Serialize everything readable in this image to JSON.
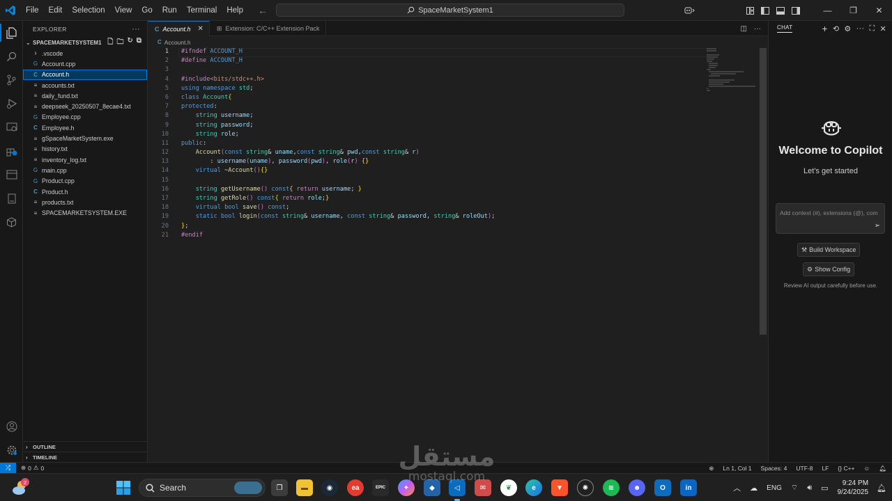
{
  "titlebar": {
    "menu": [
      "File",
      "Edit",
      "Selection",
      "View",
      "Go",
      "Run",
      "Terminal",
      "Help"
    ],
    "command_center": "SpaceMarketSystem1"
  },
  "explorer": {
    "header": "EXPLORER",
    "workspace": "SPACEMARKETSYSTEM1",
    "items": [
      {
        "name": ".vscode",
        "kind": "folder"
      },
      {
        "name": "Account.cpp",
        "kind": "cpp"
      },
      {
        "name": "Account.h",
        "kind": "c",
        "selected": true
      },
      {
        "name": "accounts.txt",
        "kind": "txt"
      },
      {
        "name": "daily_fund.txt",
        "kind": "txt"
      },
      {
        "name": "deepseek_20250507_8ecae4.txt",
        "kind": "txt"
      },
      {
        "name": "Employee.cpp",
        "kind": "cpp"
      },
      {
        "name": "Employee.h",
        "kind": "c"
      },
      {
        "name": "gSpaceMarketSystem.exe",
        "kind": "txt"
      },
      {
        "name": "history.txt",
        "kind": "txt"
      },
      {
        "name": "inventory_log.txt",
        "kind": "txt"
      },
      {
        "name": "main.cpp",
        "kind": "cpp"
      },
      {
        "name": "Product.cpp",
        "kind": "cpp"
      },
      {
        "name": "Product.h",
        "kind": "c"
      },
      {
        "name": "products.txt",
        "kind": "txt"
      },
      {
        "name": "SPACEMARKETSYSTEM.EXE",
        "kind": "txt"
      }
    ],
    "outline": "OUTLINE",
    "timeline": "TIMELINE"
  },
  "editor": {
    "tabs": [
      {
        "label": "Account.h",
        "active": true
      },
      {
        "label": "Extension: C/C++ Extension Pack",
        "active": false
      }
    ],
    "breadcrumb": "Account.h",
    "lines": [
      "#ifndef ACCOUNT_H",
      "#define ACCOUNT_H",
      "",
      "#include<bits/stdc++.h>",
      "using namespace std;",
      "class Account{",
      "protected:",
      "    string username;",
      "    string password;",
      "    string role;",
      "public:",
      "    Account(const string& uname,const string& pwd,const string& r)",
      "        : username(uname), password(pwd), role(r) {}",
      "    virtual ~Account(){}",
      "",
      "    string getUsername() const{ return username; }",
      "    string getRole() const{ return role;}",
      "    virtual bool save() const;",
      "    static bool login(const string& username, const string& password, string& roleOut);",
      "};",
      "#endif"
    ]
  },
  "chat": {
    "header": "CHAT",
    "welcome": "Welcome to Copilot",
    "subtitle": "Let's get started",
    "input_placeholder": "Add context (#), extensions (@), com",
    "build_button": "Build Workspace",
    "config_button": "Show Config",
    "review_note": "Review AI output carefully before use."
  },
  "statusbar": {
    "errors": "0",
    "warnings": "0",
    "position": "Ln 1, Col 1",
    "spaces": "Spaces: 4",
    "encoding": "UTF-8",
    "eol": "LF",
    "language": "C++"
  },
  "taskbar": {
    "search": "Search",
    "weather_badge": "2",
    "language": "ENG",
    "time": "9:24 PM",
    "date": "9/24/2025"
  },
  "watermark": {
    "arabic": "مستقل",
    "latin": "mostaql.com"
  },
  "colors": {
    "accent": "#0078d4",
    "selection": "#04395e",
    "editor_bg": "#1f1f1f",
    "sidebar_bg": "#181818"
  }
}
